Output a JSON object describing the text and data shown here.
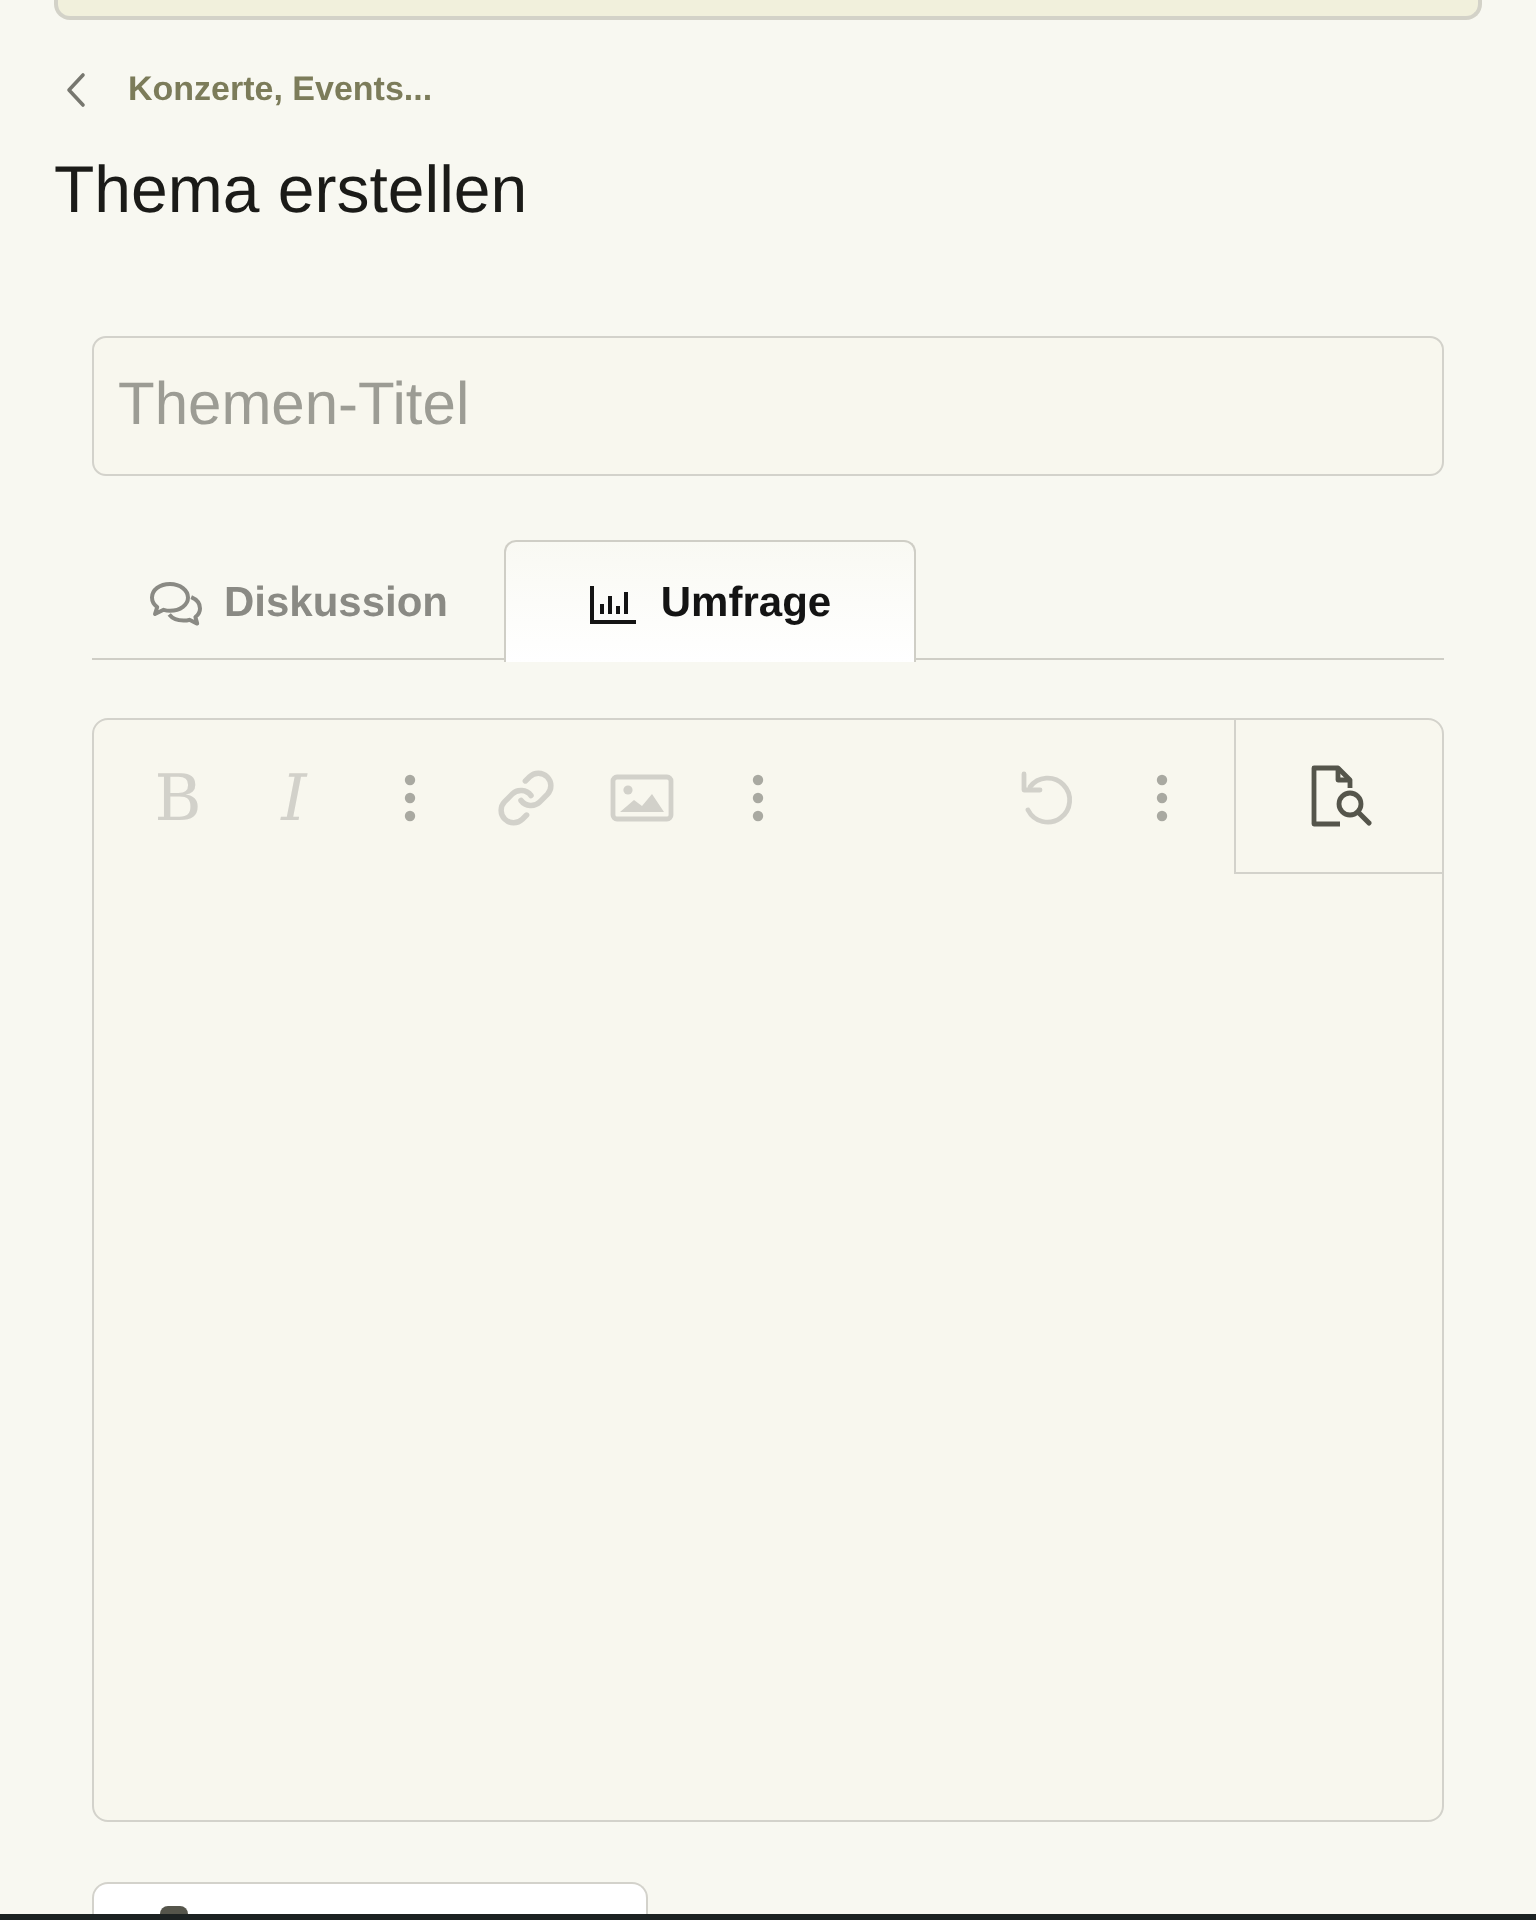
{
  "breadcrumb": {
    "label": "Konzerte, Events..."
  },
  "page_title": "Thema erstellen",
  "title_field": {
    "placeholder": "Themen-Titel"
  },
  "tabs": [
    {
      "kind": "discussion",
      "label": "Diskussion",
      "selected": false
    },
    {
      "kind": "poll",
      "label": "Umfrage",
      "selected": true
    }
  ],
  "editor": {
    "toolbar": [
      {
        "items": [
          {
            "kind": "bold",
            "label": "B",
            "disabled": true
          },
          {
            "kind": "italic",
            "label": "I",
            "disabled": true
          },
          {
            "kind": "more",
            "disabled": false
          }
        ]
      },
      {
        "items": [
          {
            "kind": "link",
            "disabled": true
          },
          {
            "kind": "image",
            "disabled": true
          },
          {
            "kind": "more",
            "disabled": false
          }
        ]
      },
      {
        "items": [
          {
            "kind": "undo",
            "disabled": true
          },
          {
            "kind": "more",
            "disabled": false
          }
        ]
      }
    ]
  }
}
